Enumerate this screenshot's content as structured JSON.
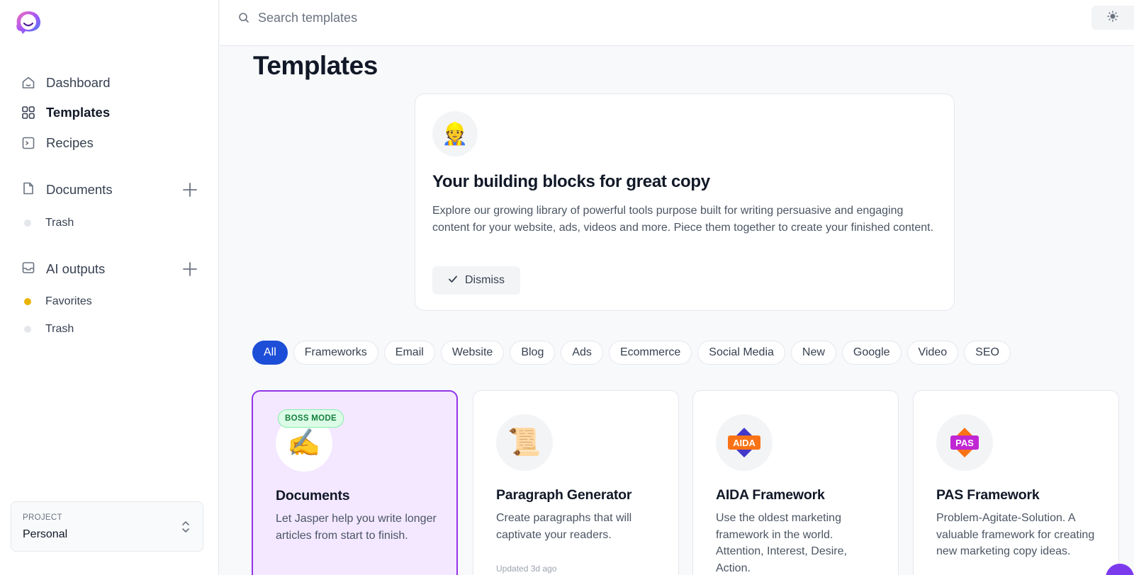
{
  "sidebar": {
    "nav": [
      {
        "label": "Dashboard",
        "icon": "home-icon"
      },
      {
        "label": "Templates",
        "icon": "grid-icon"
      },
      {
        "label": "Recipes",
        "icon": "terminal-icon"
      }
    ],
    "documents": {
      "label": "Documents",
      "items": [
        {
          "label": "Trash",
          "dot_color": "#e5e7eb"
        }
      ]
    },
    "ai_outputs": {
      "label": "AI outputs",
      "items": [
        {
          "label": "Favorites",
          "dot_color": "#eab308"
        },
        {
          "label": "Trash",
          "dot_color": "#e5e7eb"
        }
      ]
    },
    "project": {
      "label": "PROJECT",
      "value": "Personal"
    }
  },
  "search": {
    "placeholder": "Search templates"
  },
  "page": {
    "title": "Templates"
  },
  "intro": {
    "emoji": "👷",
    "title": "Your building blocks for great copy",
    "body": "Explore our growing library of powerful tools purpose built for writing persuasive and engaging content for your website, ads, videos and more. Piece them together to create your finished content.",
    "dismiss_label": "Dismiss"
  },
  "filters": [
    "All",
    "Frameworks",
    "Email",
    "Website",
    "Blog",
    "Ads",
    "Ecommerce",
    "Social Media",
    "New",
    "Google",
    "Video",
    "SEO"
  ],
  "cards": [
    {
      "title": "Documents",
      "desc": "Let Jasper help you write longer articles from start to finish.",
      "badge": "BOSS MODE",
      "icon": "✍️",
      "updated": ""
    },
    {
      "title": "Paragraph Generator",
      "desc": "Create paragraphs that will captivate your readers.",
      "badge": "",
      "icon": "📜",
      "updated": "Updated 3d ago"
    },
    {
      "title": "AIDA Framework",
      "desc": "Use the oldest marketing framework in the world. Attention, Interest, Desire, Action.",
      "badge": "",
      "icon": "AIDA",
      "updated": ""
    },
    {
      "title": "PAS Framework",
      "desc": "Problem-Agitate-Solution. A valuable framework for creating new marketing copy ideas.",
      "badge": "",
      "icon": "PAS",
      "updated": ""
    }
  ],
  "colors": {
    "accent": "#1d4ed8",
    "featured_border": "#9333ea",
    "featured_bg": "#f3e8ff"
  }
}
